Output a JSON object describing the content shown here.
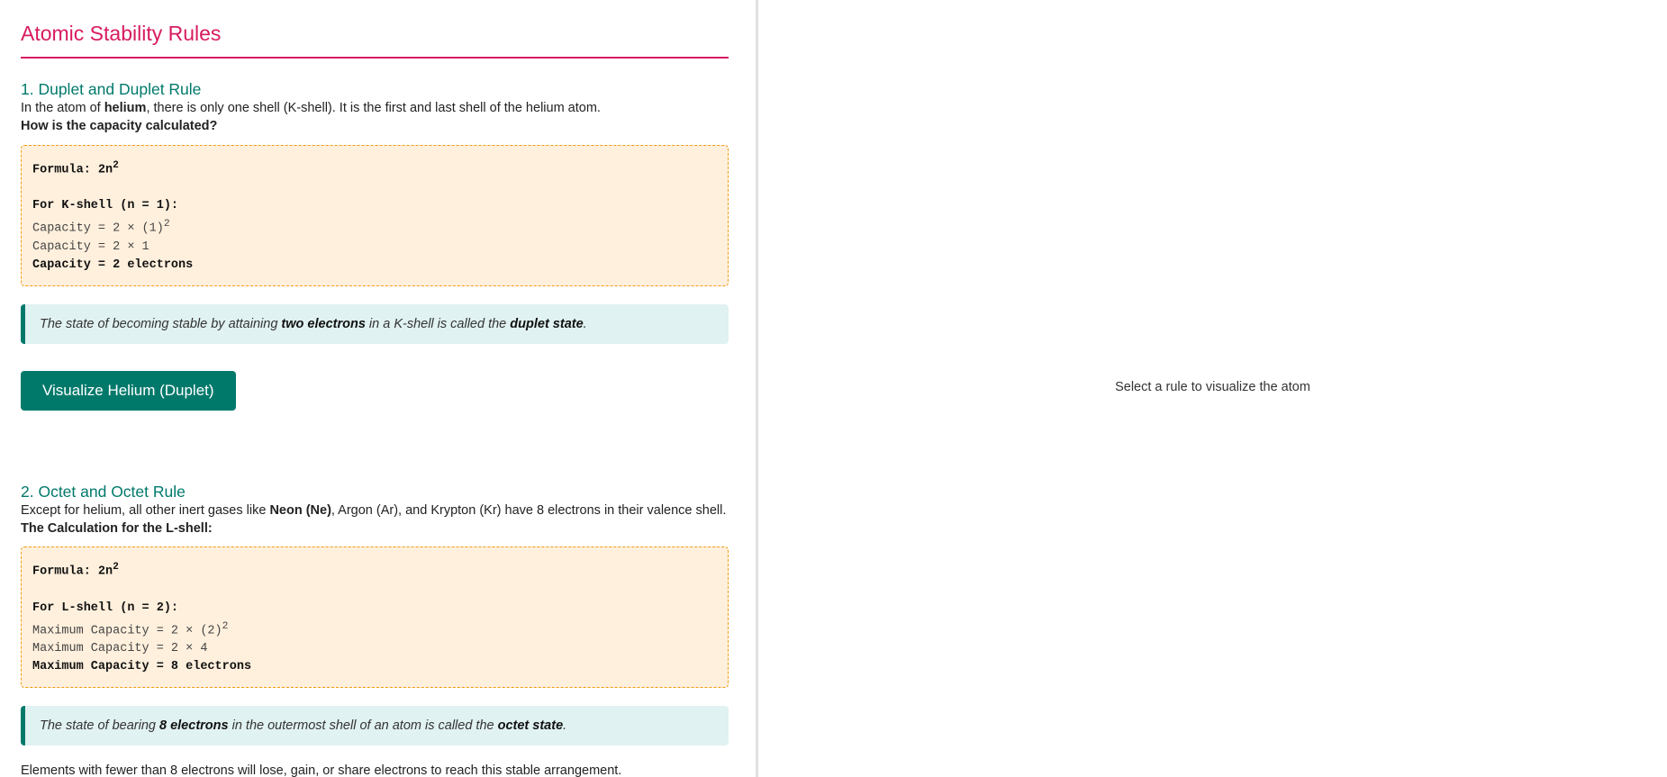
{
  "page_title": "Atomic Stability Rules",
  "section1": {
    "heading": "1. Duplet and Duplet Rule",
    "intro_before": "In the atom of ",
    "intro_bold": "helium",
    "intro_after": ", there is only one shell (K-shell). It is the first and last shell of the helium atom.",
    "subheading": "How is the capacity calculated?",
    "formula_label": "Formula: 2n",
    "formula_exp": "2",
    "shell_line": "For K-shell (n = 1):",
    "calc1": "Capacity = 2 × (1)",
    "calc1_exp": "2",
    "calc2": "Capacity = 2 × 1",
    "result": "Capacity = 2 electrons",
    "note_a": "The state of becoming stable by attaining ",
    "note_b": "two electrons",
    "note_c": " in a K-shell is called the ",
    "note_d": "duplet state",
    "note_e": ".",
    "button_label": "Visualize Helium (Duplet)"
  },
  "section2": {
    "heading": "2. Octet and Octet Rule",
    "intro_before": "Except for helium, all other inert gases like ",
    "intro_bold": "Neon (Ne)",
    "intro_after": ", Argon (Ar), and Krypton (Kr) have 8 electrons in their valence shell.",
    "subheading": "The Calculation for the L-shell:",
    "formula_label": "Formula: 2n",
    "formula_exp": "2",
    "shell_line": "For L-shell (n = 2):",
    "calc1": "Maximum Capacity = 2 × (2)",
    "calc1_exp": "2",
    "calc2": "Maximum Capacity = 2 × 4",
    "result": "Maximum Capacity = 8 electrons",
    "note_a": "The state of bearing ",
    "note_b": "8 electrons",
    "note_c": " in the outermost shell of an atom is called the ",
    "note_d": "octet state",
    "note_e": ".",
    "footer": "Elements with fewer than 8 electrons will lose, gain, or share electrons to reach this stable arrangement."
  },
  "visualizer": {
    "placeholder": "Select a rule to visualize the atom"
  },
  "colors": {
    "title": "#d81b60",
    "heading": "#00796b",
    "button": "#00796b",
    "formula_bg": "#fff0dd",
    "formula_border": "#f39c12",
    "note_bg": "#e0f2f1"
  }
}
